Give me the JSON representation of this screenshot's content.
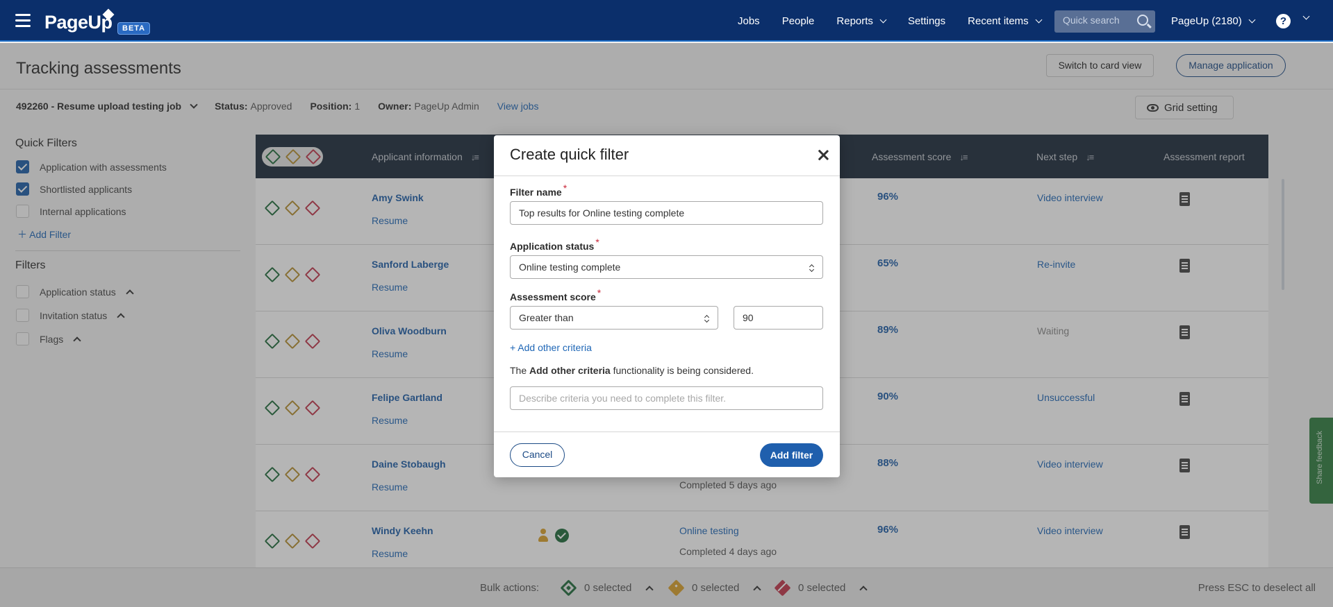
{
  "nav": {
    "logo": "PageUp",
    "beta": "BETA",
    "items": [
      {
        "label": "Jobs",
        "dropdown": false
      },
      {
        "label": "People",
        "dropdown": false
      },
      {
        "label": "Reports",
        "dropdown": true
      },
      {
        "label": "Settings",
        "dropdown": false
      },
      {
        "label": "Recent items",
        "dropdown": true
      }
    ],
    "search_placeholder": "Quick search",
    "account": "PageUp (2180)",
    "help": "?"
  },
  "header": {
    "title": "Tracking assessments",
    "switch_view": "Switch to card view",
    "manage": "Manage application"
  },
  "jobline": {
    "job": "492260 - Resume upload testing job",
    "status_label": "Status:",
    "status_value": "Approved",
    "position_label": "Position:",
    "position_value": "1",
    "owner_label": "Owner:",
    "owner_value": "PageUp Admin",
    "view_jobs": "View jobs",
    "grid_setting": "Grid setting"
  },
  "sidebar": {
    "quick_filters_title": "Quick Filters",
    "quick_filters": [
      {
        "label": "Application with assessments",
        "checked": true
      },
      {
        "label": "Shortlisted applicants",
        "checked": true
      },
      {
        "label": "Internal applications",
        "checked": false
      }
    ],
    "add_filter": "Add Filter",
    "filters_title": "Filters",
    "filters": [
      {
        "label": "Application status",
        "checked": false
      },
      {
        "label": "Invitation status",
        "checked": false
      },
      {
        "label": "Flags",
        "checked": false
      }
    ]
  },
  "table": {
    "columns": {
      "applicant": "Applicant information",
      "score": "Assessment score",
      "next": "Next step",
      "report": "Assessment report"
    },
    "rows": [
      {
        "name": "Amy Swink",
        "resume": "Resume",
        "score": "96%",
        "next": "Video interview",
        "next_grey": false
      },
      {
        "name": "Sanford Laberge",
        "resume": "Resume",
        "score": "65%",
        "next": "Re-invite",
        "next_grey": false
      },
      {
        "name": "Oliva Woodburn",
        "resume": "Resume",
        "score": "89%",
        "next": "Waiting",
        "next_grey": true
      },
      {
        "name": "Felipe Gartland",
        "resume": "Resume",
        "score": "90%",
        "next": "Unsuccessful",
        "next_grey": false
      },
      {
        "name": "Daine Stobaugh",
        "resume": "Resume",
        "score": "88%",
        "next": "Video interview",
        "next_grey": false,
        "status_sub": "Completed 5 days ago"
      },
      {
        "name": "Windy Keehn",
        "resume": "Resume",
        "score": "96%",
        "next": "Video interview",
        "next_grey": false,
        "status": "Online testing",
        "status_sub": "Completed 4 days ago"
      }
    ]
  },
  "bottombar": {
    "bulk_label": "Bulk actions:",
    "green_selected": "0 selected",
    "yellow_selected": "0 selected",
    "red_selected": "0 selected",
    "esc_hint": "Press ESC to deselect all"
  },
  "feedback": "Share feedback",
  "modal": {
    "title": "Create quick filter",
    "filter_name_label": "Filter name",
    "filter_name_value": "Top results for Online testing complete",
    "app_status_label": "Application status",
    "app_status_value": "Online testing complete",
    "score_label": "Assessment score",
    "score_operator": "Greater than",
    "score_value": "90",
    "add_criteria": "+ Add other criteria",
    "note_prefix": "The",
    "note_bold": "Add other criteria",
    "note_suffix": "functionality is being considered.",
    "describe_placeholder": "Describe criteria you need to complete this filter.",
    "required_mark": "*",
    "cancel": "Cancel",
    "add": "Add filter"
  }
}
